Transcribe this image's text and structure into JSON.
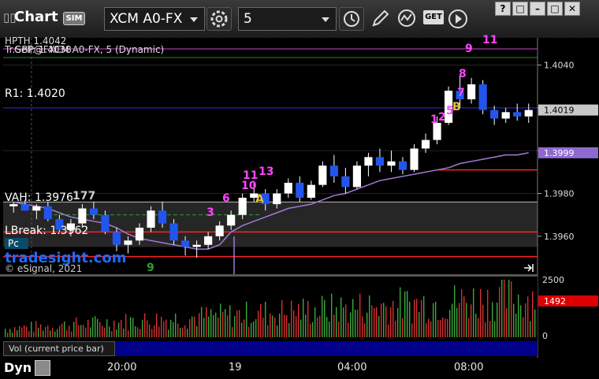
{
  "toolbar": {
    "grip": "▯▯",
    "app_title": "Chart",
    "sim_badge": "SIM",
    "symbol": "XCM A0-FX",
    "interval": "5",
    "get_label": "GET",
    "window_buttons": [
      "?",
      "□",
      "–",
      "□",
      "✕"
    ]
  },
  "chart_data": {
    "type": "candlestick",
    "title": "GBP@FXCM A0-FX, 5 (Dynamic)",
    "ylim": [
      1.3943,
      1.4052
    ],
    "y_ticks": [
      "1.4040",
      "1.4020",
      "1.4000",
      "1.3980",
      "1.3960"
    ],
    "x_ticks": [
      "20:00",
      "19",
      "04:00",
      "08:00"
    ],
    "last_price": "1.4019",
    "vwap_value": "1.3999",
    "levels": [
      {
        "label": "R1: 1.4020",
        "value": 1.402,
        "color": "#2222ff"
      },
      {
        "label": "VAH: 1.3976",
        "value": 1.3976,
        "color": "#bbbbbb"
      },
      {
        "label": "LBreak: 1.3962",
        "value": 1.3962,
        "color": "#ff2020"
      },
      {
        "label": "",
        "value": 1.39505,
        "color": "#ff2020"
      },
      {
        "label": "",
        "value": 1.3991,
        "color": "#ff2020"
      }
    ],
    "top_labels": [
      "HPTH 1.4042",
      "Tr.Sell: 1.4038"
    ],
    "value_area_lower": 1.3955,
    "annotations": [
      "9",
      "11",
      "8",
      "7",
      "B",
      "1",
      "2",
      "5",
      "11",
      "13",
      "10",
      "6",
      "3",
      "A",
      "177",
      "9"
    ],
    "watermark": "tradesight.com",
    "copyright": "© eSignal, 2021",
    "pc_label": "Pc",
    "volume": {
      "axis_ticks": [
        "2500",
        "0"
      ],
      "last_volume": "1492",
      "ylim": [
        0,
        2500
      ],
      "panel_label": "Vol (current price bar)"
    },
    "series": [
      {
        "name": "",
        "candles": [
          [
            1.3974,
            1.3976,
            1.3971,
            1.3975
          ],
          [
            1.3975,
            1.3977,
            1.3972,
            1.3972
          ],
          [
            1.3972,
            1.3975,
            1.3968,
            1.3974
          ],
          [
            1.3974,
            1.3976,
            1.3967,
            1.3968
          ],
          [
            1.3968,
            1.397,
            1.3962,
            1.3963
          ],
          [
            1.3963,
            1.3968,
            1.396,
            1.3966
          ],
          [
            1.3966,
            1.3975,
            1.3964,
            1.3973
          ],
          [
            1.3973,
            1.3976,
            1.3968,
            1.397
          ],
          [
            1.397,
            1.3972,
            1.3961,
            1.3962
          ],
          [
            1.3962,
            1.3964,
            1.3953,
            1.3956
          ],
          [
            1.3956,
            1.396,
            1.3952,
            1.3958
          ],
          [
            1.3958,
            1.3966,
            1.3956,
            1.3964
          ],
          [
            1.3964,
            1.3974,
            1.3962,
            1.3972
          ],
          [
            1.3972,
            1.3976,
            1.3964,
            1.3966
          ],
          [
            1.3966,
            1.3968,
            1.3956,
            1.3958
          ],
          [
            1.3958,
            1.396,
            1.3951,
            1.3955
          ],
          [
            1.3955,
            1.3958,
            1.395,
            1.3956
          ],
          [
            1.3956,
            1.3962,
            1.3954,
            1.396
          ],
          [
            1.396,
            1.3967,
            1.3958,
            1.3965
          ],
          [
            1.3965,
            1.3972,
            1.3963,
            1.397
          ],
          [
            1.397,
            1.398,
            1.3968,
            1.3978
          ],
          [
            1.3978,
            1.3985,
            1.3976,
            1.398
          ],
          [
            1.398,
            1.3982,
            1.3972,
            1.3975
          ],
          [
            1.3975,
            1.3982,
            1.3973,
            1.398
          ],
          [
            1.398,
            1.3987,
            1.3978,
            1.3985
          ],
          [
            1.3985,
            1.3988,
            1.3976,
            1.3978
          ],
          [
            1.3978,
            1.3986,
            1.3977,
            1.3984
          ],
          [
            1.3984,
            1.3995,
            1.3983,
            1.3993
          ],
          [
            1.3993,
            1.3998,
            1.3985,
            1.3988
          ],
          [
            1.3988,
            1.3992,
            1.398,
            1.3983
          ],
          [
            1.3983,
            1.3995,
            1.3982,
            1.3993
          ],
          [
            1.3993,
            1.3999,
            1.3988,
            1.3997
          ],
          [
            1.3997,
            1.4001,
            1.399,
            1.3993
          ],
          [
            1.3993,
            1.4,
            1.399,
            1.3995
          ],
          [
            1.3995,
            1.3997,
            1.3989,
            1.3991
          ],
          [
            1.3991,
            1.4003,
            1.399,
            1.4001
          ],
          [
            1.4001,
            1.4008,
            1.3999,
            1.4005
          ],
          [
            1.4005,
            1.4016,
            1.4003,
            1.4013
          ],
          [
            1.4013,
            1.403,
            1.4012,
            1.4028
          ],
          [
            1.4028,
            1.4035,
            1.402,
            1.4024
          ],
          [
            1.4024,
            1.4034,
            1.4022,
            1.4031
          ],
          [
            1.4031,
            1.4033,
            1.4017,
            1.4019
          ],
          [
            1.4019,
            1.4021,
            1.4012,
            1.4015
          ],
          [
            1.4015,
            1.402,
            1.4013,
            1.4018
          ],
          [
            1.4018,
            1.4022,
            1.4014,
            1.4016
          ],
          [
            1.4016,
            1.4022,
            1.4013,
            1.4019
          ]
        ]
      },
      {
        "name": "",
        "values": [
          1.3976,
          1.3975,
          1.3974,
          1.3973,
          1.3971,
          1.3969,
          1.3968,
          1.3967,
          1.3966,
          1.3964,
          1.3961,
          1.3959,
          1.3958,
          1.3957,
          1.3956,
          1.3955,
          1.3954,
          1.3954,
          1.3956,
          1.3962,
          1.3965,
          1.3967,
          1.3969,
          1.3971,
          1.3973,
          1.3974,
          1.3975,
          1.3977,
          1.3979,
          1.398,
          1.3982,
          1.3984,
          1.3986,
          1.3987,
          1.3988,
          1.3989,
          1.399,
          1.3991,
          1.3992,
          1.3994,
          1.3995,
          1.3996,
          1.3997,
          1.3998,
          1.3998,
          1.3999
        ]
      }
    ]
  }
}
